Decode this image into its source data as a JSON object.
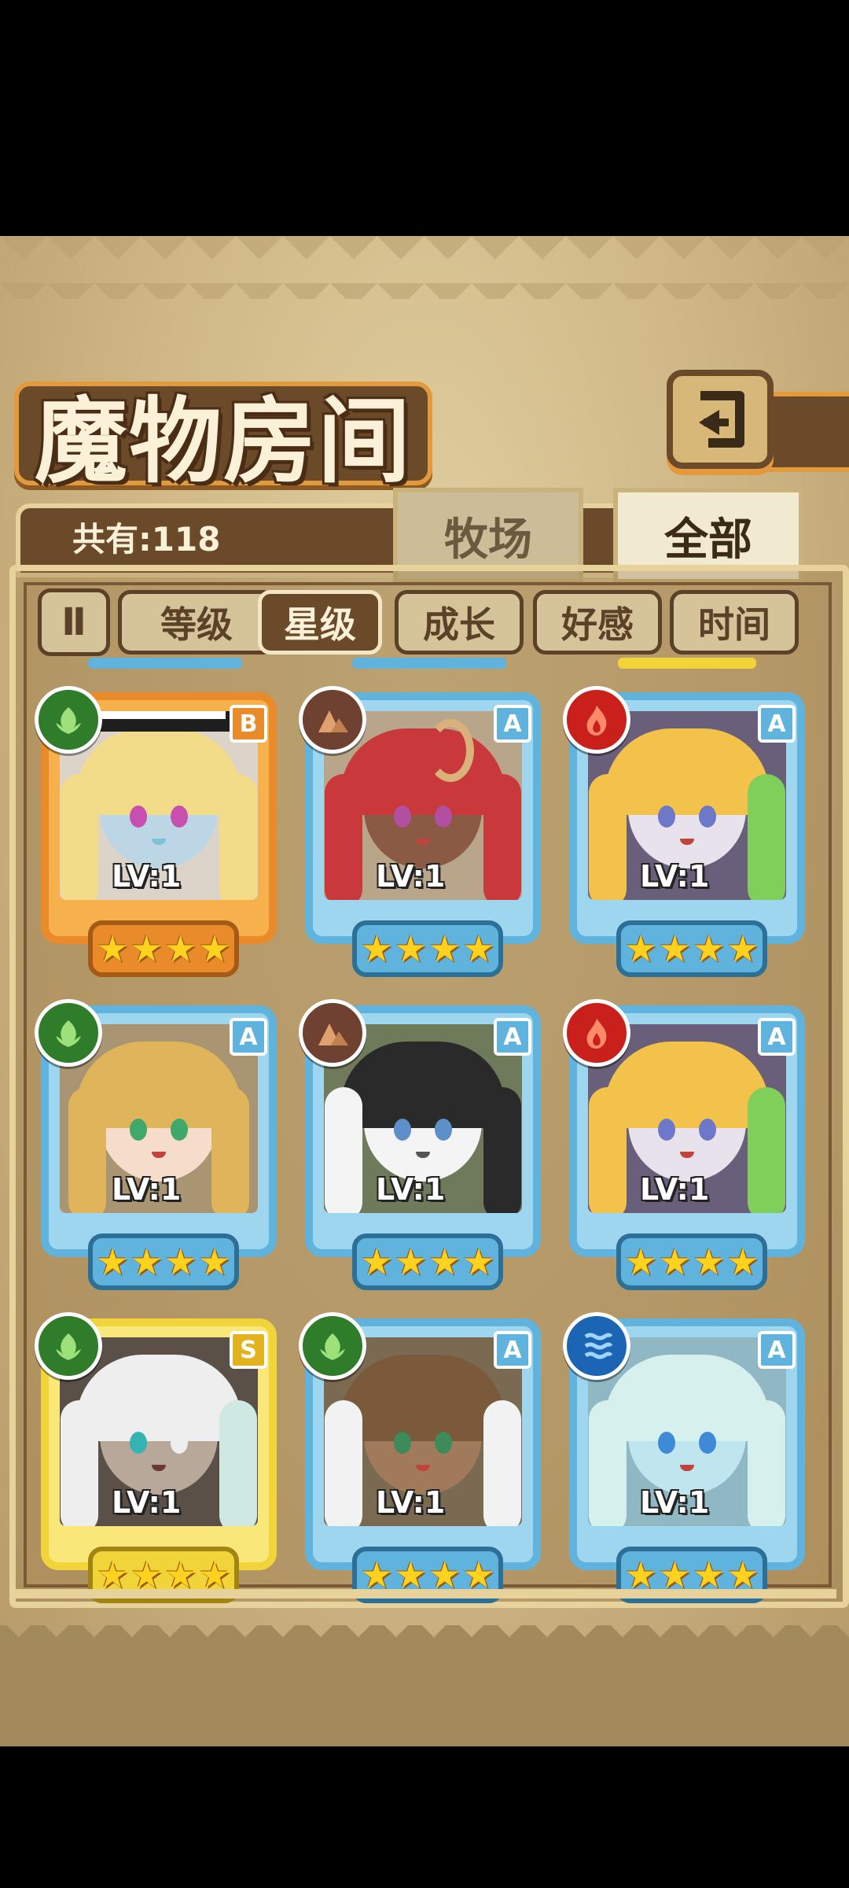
{
  "header": {
    "title": "魔物房间"
  },
  "count": {
    "label": "共有:118"
  },
  "tabs": [
    {
      "label": "牧场"
    },
    {
      "label": "全部"
    }
  ],
  "sort_toggle_label": "Ⅱ",
  "filters": [
    {
      "label": "等级"
    },
    {
      "label": "星级"
    },
    {
      "label": "成长"
    },
    {
      "label": "好感"
    },
    {
      "label": "时间"
    }
  ],
  "selected_filter": "星级",
  "colors": {
    "frame_orange": "#e98b2a",
    "frame_blue": "#5fb3dd",
    "frame_gold": "#f0d43a",
    "element_nature": "#2f7d2a",
    "element_earth": "#6e4130",
    "element_fire": "#c9201c",
    "element_water": "#1c65b5"
  },
  "cards": [
    {
      "rank": "B",
      "level": "LV:1",
      "stars": 4,
      "element": "nature-icon",
      "frame": "orange"
    },
    {
      "rank": "A",
      "level": "LV:1",
      "stars": 4,
      "element": "earth-icon",
      "frame": "blue"
    },
    {
      "rank": "A",
      "level": "LV:1",
      "stars": 4,
      "element": "fire-icon",
      "frame": "blue"
    },
    {
      "rank": "A",
      "level": "LV:1",
      "stars": 4,
      "element": "nature-icon",
      "frame": "blue"
    },
    {
      "rank": "A",
      "level": "LV:1",
      "stars": 4,
      "element": "earth-icon",
      "frame": "blue"
    },
    {
      "rank": "A",
      "level": "LV:1",
      "stars": 4,
      "element": "fire-icon",
      "frame": "blue"
    },
    {
      "rank": "S",
      "level": "LV:1",
      "stars": 4,
      "element": "nature-icon",
      "frame": "gold"
    },
    {
      "rank": "A",
      "level": "LV:1",
      "stars": 4,
      "element": "nature-icon",
      "frame": "blue"
    },
    {
      "rank": "A",
      "level": "LV:1",
      "stars": 4,
      "element": "water-icon",
      "frame": "blue"
    }
  ]
}
